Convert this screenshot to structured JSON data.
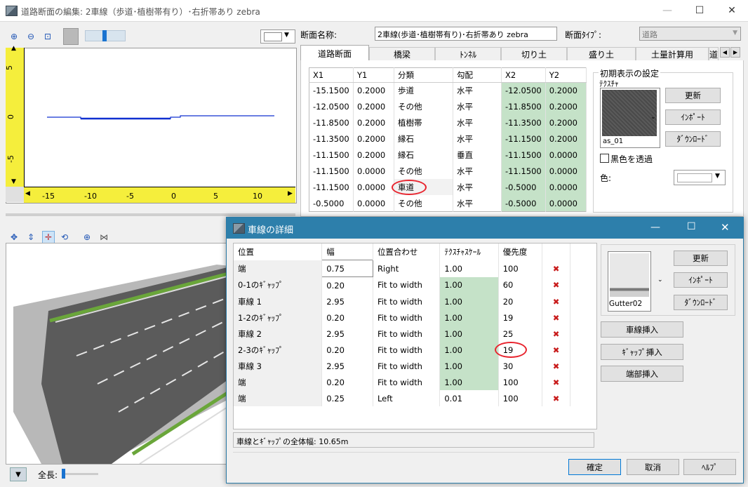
{
  "window": {
    "title": "道路断面の編集: 2車線（歩道･植樹帯有り）･右折帯あり zebra"
  },
  "left": {
    "ruler_y": [
      "5",
      "0",
      "-5"
    ],
    "ruler_x": [
      "-15",
      "-10",
      "-5",
      "0",
      "5",
      "10"
    ],
    "length_label": "全長:"
  },
  "section": {
    "name_label": "断面名称:",
    "name_value": "2車線(歩道･植樹帯有り)･右折帯あり zebra",
    "type_label": "断面ﾀｲﾌﾟ:",
    "type_value": "道路",
    "tabs": [
      "道路断面",
      "橋梁",
      "ﾄﾝﾈﾙ",
      "切り土",
      "盛り土",
      "土量計算用",
      "道"
    ],
    "columns": [
      "X1",
      "Y1",
      "分類",
      "勾配",
      "X2",
      "Y2"
    ],
    "rows": [
      [
        "-15.1500",
        "0.2000",
        "歩道",
        "水平",
        "-12.0500",
        "0.2000"
      ],
      [
        "-12.0500",
        "0.2000",
        "その他",
        "水平",
        "-11.8500",
        "0.2000"
      ],
      [
        "-11.8500",
        "0.2000",
        "植樹帯",
        "水平",
        "-11.3500",
        "0.2000"
      ],
      [
        "-11.3500",
        "0.2000",
        "縁石",
        "水平",
        "-11.1500",
        "0.2000"
      ],
      [
        "-11.1500",
        "0.2000",
        "縁石",
        "垂直",
        "-11.1500",
        "0.0000"
      ],
      [
        "-11.1500",
        "0.0000",
        "その他",
        "水平",
        "-11.1500",
        "0.0000"
      ],
      [
        "-11.1500",
        "0.0000",
        "車道",
        "水平",
        "-0.5000",
        "0.0000"
      ],
      [
        "-0.5000",
        "0.0000",
        "その他",
        "水平",
        "-0.5000",
        "0.0000"
      ]
    ]
  },
  "initial_display": {
    "group_title": "初期表示の設定",
    "texture_label": "ﾃｸｽﾁｬ",
    "texture_name": "as_01",
    "update_button": "更新",
    "import_button": "ｲﾝﾎﾟｰﾄ",
    "download_button": "ﾀﾞｳﾝﾛｰﾄﾞ",
    "transparent_label": "黒色を透過",
    "color_label": "色:"
  },
  "dialog": {
    "title": "車線の詳細",
    "columns": [
      "位置",
      "幅",
      "位置合わせ",
      "ﾃｸｽﾁｬｽｹｰﾙ",
      "優先度"
    ],
    "rows": [
      [
        "端",
        "0.75",
        "Right",
        "1.00",
        "100"
      ],
      [
        "0-1のｷﾞｬｯﾌﾟ",
        "0.20",
        "Fit to width",
        "1.00",
        "60"
      ],
      [
        "車線 1",
        "2.95",
        "Fit to width",
        "1.00",
        "20"
      ],
      [
        "1-2のｷﾞｬｯﾌﾟ",
        "0.20",
        "Fit to width",
        "1.00",
        "19"
      ],
      [
        "車線 2",
        "2.95",
        "Fit to width",
        "1.00",
        "25"
      ],
      [
        "2-3のｷﾞｬｯﾌﾟ",
        "0.20",
        "Fit to width",
        "1.00",
        "19"
      ],
      [
        "車線 3",
        "2.95",
        "Fit to width",
        "1.00",
        "30"
      ],
      [
        "端",
        "0.20",
        "Fit to width",
        "1.00",
        "100"
      ],
      [
        "端",
        "0.25",
        "Left",
        "0.01",
        "100"
      ]
    ],
    "texture_name": "Gutter02",
    "update_button": "更新",
    "import_button": "ｲﾝﾎﾟｰﾄ",
    "download_button": "ﾀﾞｳﾝﾛｰﾄﾞ",
    "insert_lane_button": "車線挿入",
    "insert_gap_button": "ｷﾞｬｯﾌﾟ挿入",
    "insert_edge_button": "端部挿入",
    "total_width": "車線とｷﾞｬｯﾌﾟの全体幅: 10.65m",
    "ok_button": "確定",
    "cancel_button": "取消",
    "help_button": "ﾍﾙﾌﾟ"
  }
}
